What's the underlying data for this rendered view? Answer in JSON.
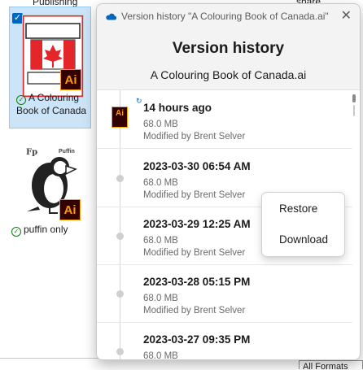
{
  "background": {
    "top_left_text": "Publishing",
    "top_right_text": "share",
    "right_edge_text": "r",
    "files": [
      {
        "name": "A Colouring Book of Canada",
        "badge": "Ai"
      },
      {
        "name": "puffin only",
        "badge": "Ai"
      }
    ],
    "puffin_logo_text": "Fp",
    "puffin_brand_text": "Puffin",
    "filter_select_value": "All Formats"
  },
  "flyout": {
    "window_title": "Version history \"A Colouring Book of Canada.ai\"",
    "close_symbol": "✕",
    "heading": "Version history",
    "file_name": "A Colouring Book of Canada.ai",
    "file_icon_label": "Ai",
    "versions": [
      {
        "date": "14 hours ago",
        "size": "68.0 MB",
        "modified_by": "Modified by Brent Selver"
      },
      {
        "date": "2023-03-30 06:54 AM",
        "size": "68.0 MB",
        "modified_by": "Modified by Brent Selver"
      },
      {
        "date": "2023-03-29 12:25 AM",
        "size": "68.0 MB",
        "modified_by": "Modified by Brent Selver"
      },
      {
        "date": "2023-03-28 05:15 PM",
        "size": "68.0 MB",
        "modified_by": "Modified by Brent Selver"
      },
      {
        "date": "2023-03-27 09:35 PM",
        "size": "68.0 MB",
        "modified_by": ""
      }
    ]
  },
  "context_menu": {
    "restore_label": "Restore",
    "download_label": "Download"
  },
  "colors": {
    "accent": "#0067c0",
    "ai_orange": "#ff9a00",
    "ai_dark": "#330000",
    "selection": "#cce4f7",
    "canada_red": "#e4262b"
  }
}
